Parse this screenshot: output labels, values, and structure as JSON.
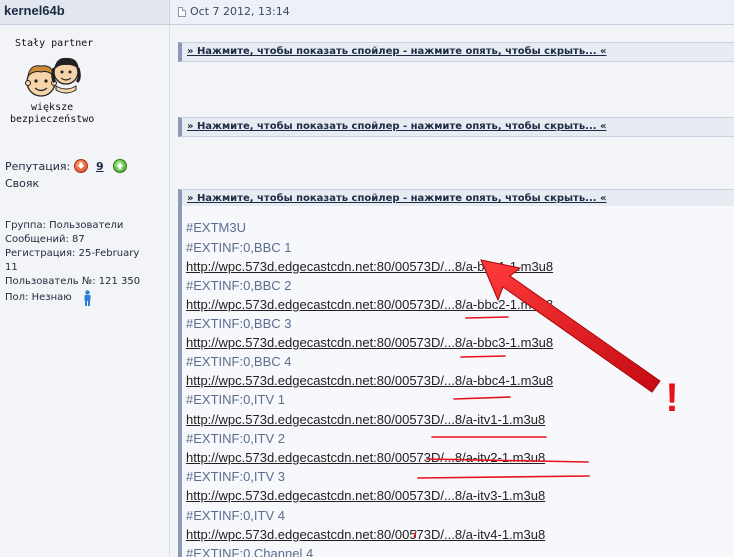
{
  "header": {
    "username": "kernel64b",
    "post_date": "Oct 7 2012, 13:14"
  },
  "user": {
    "partner_line1": "Stały partner",
    "partner_line2": "większe",
    "partner_line3": "bezpieczeństwo",
    "reputation_label": "Репутация:",
    "reputation_value": "9",
    "status": "Свояк",
    "group": "Группа: Пользователи",
    "posts": "Сообщений: 87",
    "registered_line1": "Регистрация: 25-February",
    "registered_line2": "11",
    "user_number": "Пользователь №: 121 350",
    "gender": "Пол: Незнаю"
  },
  "spoilers": [
    {
      "label": "» Нажмите, чтобы показать спойлер - нажмите опять, чтобы скрыть... «"
    },
    {
      "label": "» Нажмите, чтобы показать спойлер - нажмите опять, чтобы скрыть... «"
    },
    {
      "label": "» Нажмите, чтобы показать спойлер - нажмите опять, чтобы скрыть... «"
    }
  ],
  "playlist": {
    "lines": [
      "#EXTM3U",
      "#EXTINF:0,BBC 1",
      "http://wpc.573d.edgecastcdn.net:80/00573D/...8/a-bbc1-1.m3u8",
      "#EXTINF:0,BBC 2",
      "http://wpc.573d.edgecastcdn.net:80/00573D/...8/a-bbc2-1.m3u8",
      "#EXTINF:0,BBC 3",
      "http://wpc.573d.edgecastcdn.net:80/00573D/...8/a-bbc3-1.m3u8",
      "#EXTINF:0,BBC 4",
      "http://wpc.573d.edgecastcdn.net:80/00573D/...8/a-bbc4-1.m3u8",
      "#EXTINF:0,ITV 1",
      "http://wpc.573d.edgecastcdn.net:80/00573D/...8/a-itv1-1.m3u8",
      "#EXTINF:0,ITV 2",
      "http://wpc.573d.edgecastcdn.net:80/00573D/...8/a-itv2-1.m3u8",
      "#EXTINF:0,ITV 3",
      "http://wpc.573d.edgecastcdn.net:80/00573D/...8/a-itv3-1.m3u8",
      "#EXTINF:0,ITV 4",
      "http://wpc.573d.edgecastcdn.net:80/00573D/...8/a-itv4-1.m3u8",
      "#EXTINF:0,Channel 4"
    ]
  },
  "annotation": {
    "mark": "!",
    "color": "#e8101a"
  },
  "colors": {
    "extinf_text": "#5b6e8e",
    "url_text": "#222222",
    "spoiler_border": "#8b9bb7"
  }
}
